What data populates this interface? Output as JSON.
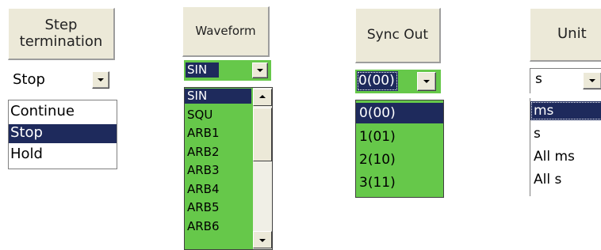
{
  "panels": {
    "step_termination": {
      "header": "Step termination",
      "value": "Stop",
      "options": [
        "Continue",
        "Stop",
        "Hold"
      ],
      "selected": "Stop"
    },
    "waveform": {
      "header": "Waveform",
      "value": "SIN",
      "options": [
        "SIN",
        "SQU",
        "ARB1",
        "ARB2",
        "ARB3",
        "ARB4",
        "ARB5",
        "ARB6"
      ],
      "selected": "SIN",
      "list_color": "#66c84a"
    },
    "sync_out": {
      "header": "Sync Out",
      "value": "0(00)",
      "options": [
        "0(00)",
        "1(01)",
        "2(10)",
        "3(11)"
      ],
      "selected": "0(00)",
      "list_color": "#66c84a"
    },
    "unit": {
      "header": "Unit",
      "value": "s",
      "options": [
        "ms",
        "s",
        "All ms",
        "All s"
      ],
      "selected": "ms"
    }
  },
  "icons": [
    "chevron-down-icon",
    "scroll-up-arrow-icon",
    "scroll-down-arrow-icon"
  ],
  "colors": {
    "selection": "#1e2a5c",
    "header_bg": "#ece9d8"
  }
}
